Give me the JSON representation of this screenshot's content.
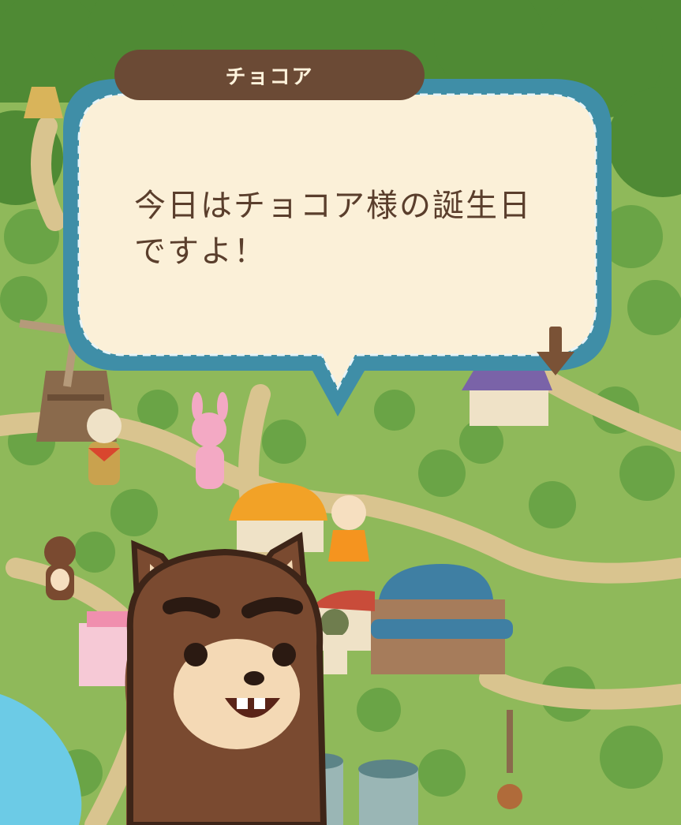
{
  "dialog": {
    "speaker": "チョコア",
    "message": "今日はチョコア様の誕生日\nですよ！"
  },
  "icons": {
    "next": "down-arrow-icon",
    "speaker_portrait": "brown-bear-character"
  },
  "colors": {
    "dialog_fill": "#fbf0d8",
    "dialog_border": "#3f8ea7",
    "dialog_stitch": "#e7f4f8",
    "speaker_tab": "#6b4a35",
    "text": "#5a3e2c",
    "map_grass": "#8fb95a",
    "map_road": "#d9c48f",
    "map_water": "#6ccbe6"
  }
}
